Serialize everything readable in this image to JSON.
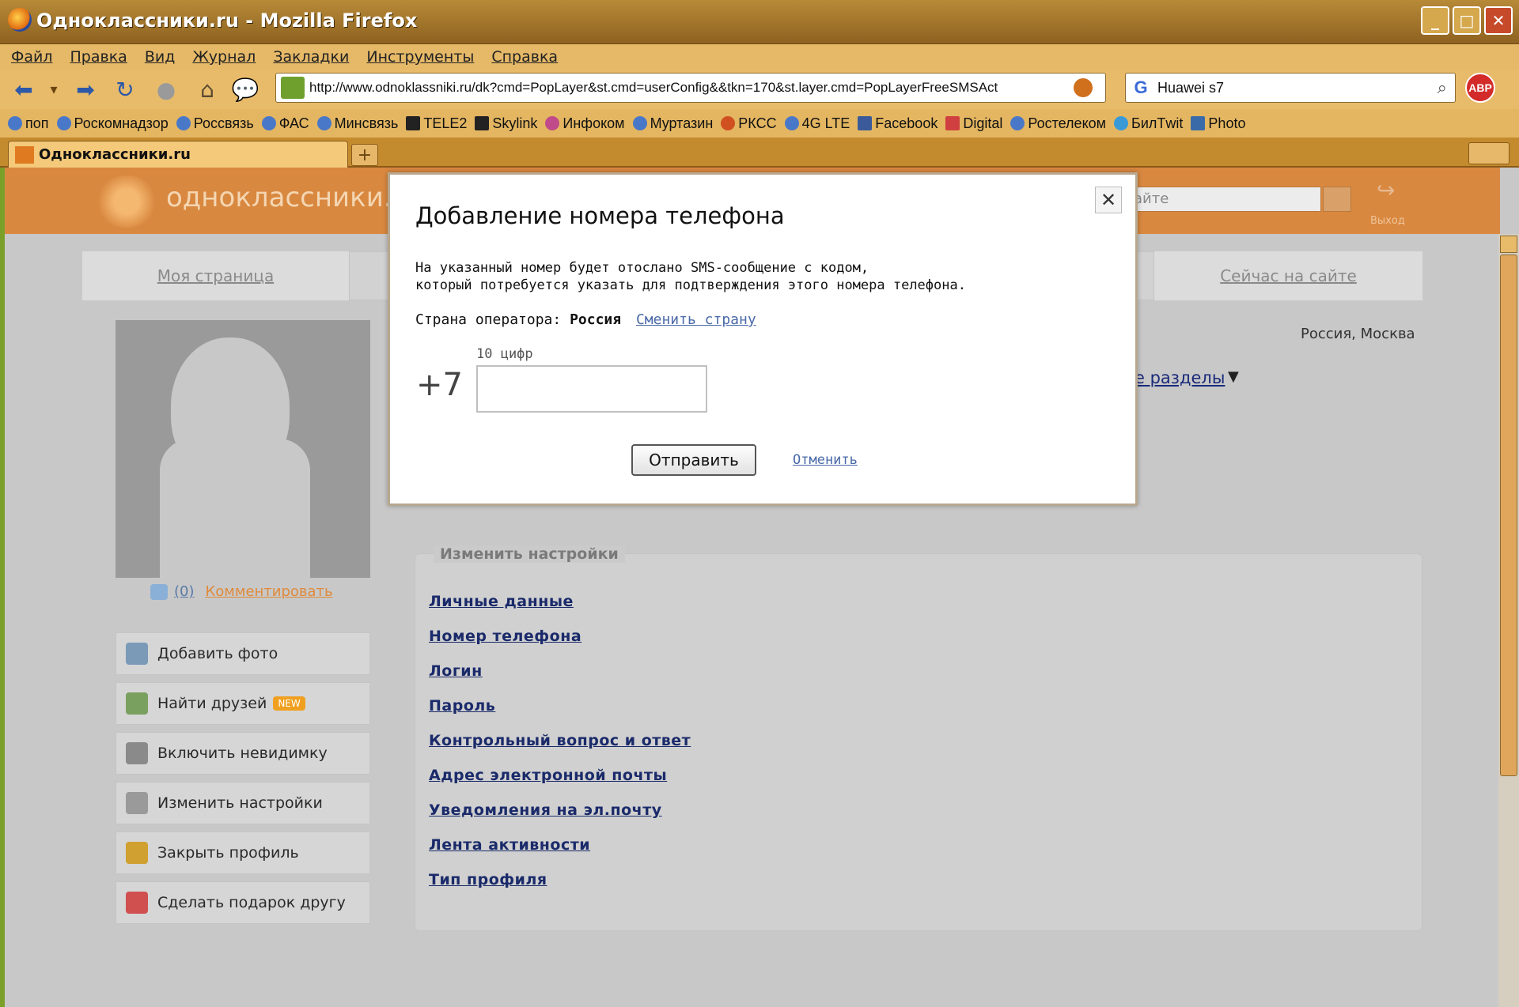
{
  "window": {
    "title": "Одноклассники.ru - Mozilla Firefox"
  },
  "menu": [
    "Файл",
    "Правка",
    "Вид",
    "Журнал",
    "Закладки",
    "Инструменты",
    "Справка"
  ],
  "address": {
    "url": "http://www.odnoklassniki.ru/dk?cmd=PopLayer&st.cmd=userConfig&&tkn=170&st.layer.cmd=PopLayerFreeSMSAct"
  },
  "search": {
    "query": "Huawei s7",
    "engine_icon": "G"
  },
  "abp": "ABP",
  "bookmarks": [
    "поп",
    "Роскомнадзор",
    "Россвязь",
    "ФАС",
    "Минсвязь",
    "TELE2",
    "Skylink",
    "Инфоком",
    "Муртазин",
    "РКСС",
    "4G LTE",
    "Facebook",
    "Digital",
    "Ростелеком",
    "БилТwit",
    "Photo"
  ],
  "tab": {
    "title": "Одноклассники.ru",
    "new_tab": "+"
  },
  "site": {
    "logo_text": "одноклассники.ru",
    "search_placeholder": "айте",
    "exit_label": "Выход",
    "nav_my_page": "Моя страница",
    "nav_online": "Сейчас на сайте",
    "location": "Россия, Москва",
    "sections": "е разделы",
    "sections_arrow": "▼",
    "comment_count": "(0)",
    "comment_link": "Комментировать"
  },
  "side_menu": [
    {
      "label": "Добавить фото",
      "color": "#7a9ab8"
    },
    {
      "label": "Найти друзей",
      "badge": "NEW",
      "color": "#7aa060"
    },
    {
      "label": "Включить невидимку",
      "color": "#8a8a8a"
    },
    {
      "label": "Изменить настройки",
      "color": "#9a9a9a"
    },
    {
      "label": "Закрыть профиль",
      "color": "#d0a030"
    },
    {
      "label": "Сделать подарок другу",
      "color": "#d05050"
    }
  ],
  "settings": {
    "title": "Изменить настройки",
    "links": [
      "Личные данные",
      "Номер телефона",
      "Логин",
      "Пароль",
      "Контрольный вопрос и ответ",
      "Адрес электронной почты",
      "Уведомления на эл.почту",
      "Лента активности",
      "Тип профиля"
    ]
  },
  "modal": {
    "title": "Добавление номера телефона",
    "description": "На указанный номер будет отослано SMS-сообщение с кодом,\nкоторый потребуется указать для подтверждения этого номера телефона.",
    "country_label": "Страна оператора:",
    "country": "Россия",
    "change_country": "Сменить страну",
    "hint": "10 цифр",
    "prefix": "+7",
    "phone_value": "",
    "send": "Отправить",
    "cancel": "Отменить",
    "close": "✕"
  }
}
